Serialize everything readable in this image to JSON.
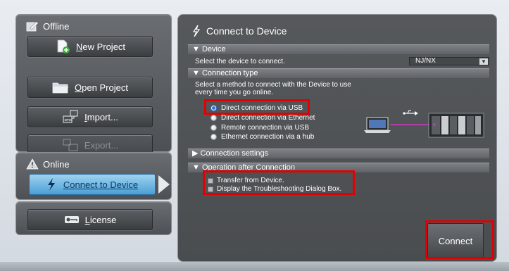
{
  "sidebar": {
    "offline": {
      "header": "Offline",
      "buttons": [
        {
          "label_prefix": "",
          "label_underlined": "N",
          "label_rest": "ew Project"
        },
        {
          "label_prefix": "",
          "label_underlined": "O",
          "label_rest": "pen Project"
        },
        {
          "label_prefix": "",
          "label_underlined": "I",
          "label_rest": "mport..."
        },
        {
          "label_prefix": "",
          "label_underlined": "",
          "label_rest": "Export..."
        }
      ]
    },
    "online": {
      "header": "Online",
      "connect_label": "Connect to Device"
    },
    "license": {
      "label_underlined": "L",
      "label_rest": "icense"
    }
  },
  "main": {
    "title": "Connect to Device",
    "device_section": {
      "header": "▼ Device",
      "instruction": "Select the device to connect.",
      "selected_device": "NJ/NX"
    },
    "connection_type": {
      "header": "▼ Connection type",
      "instruction_line1": "Select a method to connect with the Device to use",
      "instruction_line2": "every time you go online.",
      "options": [
        {
          "label": "Direct connection via USB",
          "selected": true
        },
        {
          "label": "Direct connection via Ethernet",
          "selected": false
        },
        {
          "label": "Remote connection via USB",
          "selected": false
        },
        {
          "label": "Ethernet connection via a hub",
          "selected": false
        }
      ]
    },
    "connection_settings": {
      "header": "▶ Connection settings"
    },
    "operation_after_connection": {
      "header": "▼ Operation after Connection",
      "options": [
        {
          "label": "Transfer from Device.",
          "checked": false
        },
        {
          "label": "Display the Troubleshooting Dialog Box.",
          "checked": false
        }
      ]
    },
    "connect_button_label": "Connect"
  },
  "colors": {
    "highlight": "#e30000",
    "selected_blue": "#4aa0d6",
    "panel_dark": "#4a4d50"
  }
}
